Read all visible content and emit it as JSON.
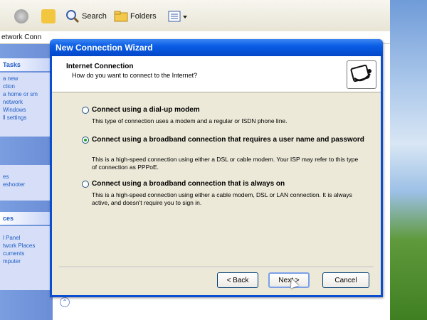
{
  "explorer": {
    "toolbar": {
      "search_label": "Search",
      "folders_label": "Folders"
    },
    "address": "etwork Conn",
    "side_panel": {
      "tasks_header": "Tasks",
      "tasks_items": [
        "a new",
        "ction",
        "a home or sm",
        "network",
        "Windows",
        "ll settings"
      ],
      "troubleshoot_items": [
        "es",
        "eshooter"
      ],
      "places_header": "ces",
      "places_items": [
        "l Panel",
        "twork Places",
        "cuments",
        "mputer"
      ]
    }
  },
  "dialog": {
    "title": "New Connection Wizard",
    "header": {
      "title": "Internet Connection",
      "subtitle": "How do you want to connect to the Internet?"
    },
    "options": [
      {
        "label": "Connect using a dial-up modem",
        "description": "This type of connection uses a modem and a regular or ISDN phone line.",
        "selected": false
      },
      {
        "label": "Connect using a broadband connection that requires a user name and password",
        "description": "This is a high-speed connection using either a DSL or cable modem. Your ISP may refer to this type of connection as PPPoE.",
        "selected": true
      },
      {
        "label": "Connect using a broadband connection that is always on",
        "description": "This is a high-speed connection using either a cable modem, DSL or LAN connection. It is always active, and doesn't require you to sign in.",
        "selected": false
      }
    ],
    "buttons": {
      "back": "< Back",
      "next": "Next >",
      "cancel": "Cancel"
    }
  },
  "colors": {
    "title_bar": "#0a5ee6",
    "dialog_face": "#ece9d8",
    "radio_selected": "#21a121"
  }
}
